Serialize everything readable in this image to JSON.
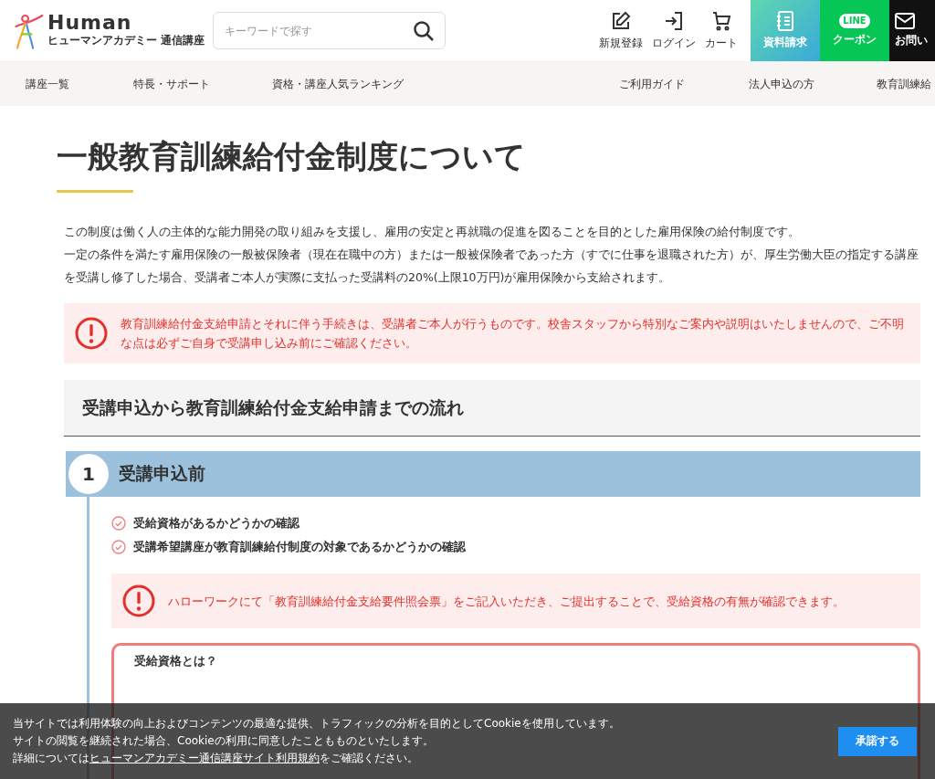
{
  "header": {
    "logo": {
      "wordmark": "Human",
      "tagline": "ヒューマンアカデミー 通信講座"
    },
    "search": {
      "placeholder": "キーワードで探す"
    },
    "icon_links": [
      {
        "kind": "register",
        "label": "新規登録"
      },
      {
        "kind": "login",
        "label": "ログイン"
      },
      {
        "kind": "cart",
        "label": "カート"
      }
    ],
    "cta_buttons": [
      {
        "kind": "brochure",
        "label": "資料請求"
      },
      {
        "kind": "line",
        "label": "クーポン",
        "icon_text": "LINE"
      },
      {
        "kind": "contact",
        "label": "お問い"
      }
    ]
  },
  "nav": {
    "left": [
      "講座一覧",
      "特長・サポート",
      "資格・講座人気ランキング"
    ],
    "right": [
      "ご利用ガイド",
      "法人申込の方",
      "教育訓練給"
    ]
  },
  "page_title": "一般教育訓練給付金制度について",
  "intro": [
    "この制度は働く人の主体的な能力開発の取り組みを支援し、雇用の安定と再就職の促進を図ることを目的とした雇用保険の給付制度です。",
    "一定の条件を満たす雇用保険の一般被保険者（現在在職中の方）または一般被保険者であった方（すでに仕事を退職された方）が、厚生労働大臣の指定する講座を受講し修了した場合、受講者ご本人が実際に支払った受講料の20%(上限10万円)が雇用保険から支給されます。"
  ],
  "notice": "教育訓練給付金支給申請とそれに伴う手続きは、受講者ご本人が行うものです。校舎スタッフから特別なご案内や説明はいたしませんので、ご不明な点は必ずご自身で受講申し込み前にご確認ください。",
  "flow": {
    "heading": "受講申込から教育訓練給付金支給申請までの流れ",
    "steps": [
      {
        "number": "1",
        "title": "受講申込前",
        "checks": [
          "受給資格があるかどうかの確認",
          "受講希望講座が教育訓練給付制度の対象であるかどうかの確認"
        ],
        "notice": "ハローワークにて「教育訓練給付金支給要件照会票」をご記入いただき、ご提出することで、受給資格の有無が確認できます。",
        "info_box": {
          "title": "受給資格とは？"
        }
      }
    ]
  },
  "cookie_banner": {
    "lines": [
      "当サイトでは利用体験の向上およびコンテンツの最適な提供、トラフィックの分析を目的としてCookieを使用しています。",
      "サイトの閲覧を継続された場合、Cookieの利用に同意したこともものといたします。"
    ],
    "last_line": {
      "before": "詳細については",
      "link": "ヒューマンアカデミー通信講座サイト利用規約",
      "after": "をご確認ください。"
    },
    "accept": "承諾する"
  }
}
